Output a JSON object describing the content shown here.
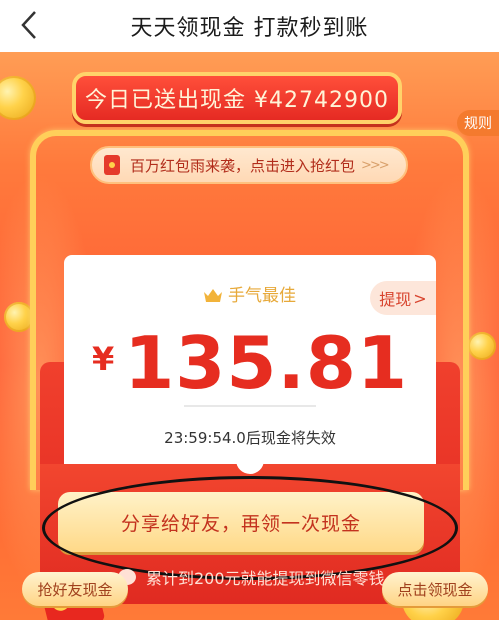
{
  "header": {
    "title": "天天领现金 打款秒到账",
    "back_icon": "chevron-left-icon"
  },
  "rules_label": "规则",
  "banner": {
    "text": "今日已送出现金 ¥42742900"
  },
  "promo_pill": {
    "text": "百万红包雨来袭，点击进入抢红包",
    "arrows": ">>>",
    "icon": "red-envelope-icon"
  },
  "card": {
    "best_luck": "手气最佳",
    "withdraw_label": "提现",
    "withdraw_arrow": ">",
    "currency": "¥",
    "amount": "135.81",
    "expire_text": "23:59:54.0后现金将失效"
  },
  "share_button": {
    "label": "分享给好友，再领一次现金"
  },
  "wechat_note": {
    "text": "累计到200元就能提现到微信零钱",
    "icon": "wechat-icon"
  },
  "bottom": {
    "left_label": "抢好友现金",
    "right_label": "点击领现金",
    "money_symbol": "¥"
  },
  "colors": {
    "accent_red": "#e62d20",
    "gold": "#ffcf5a",
    "background_orange": "#ff5b34"
  }
}
